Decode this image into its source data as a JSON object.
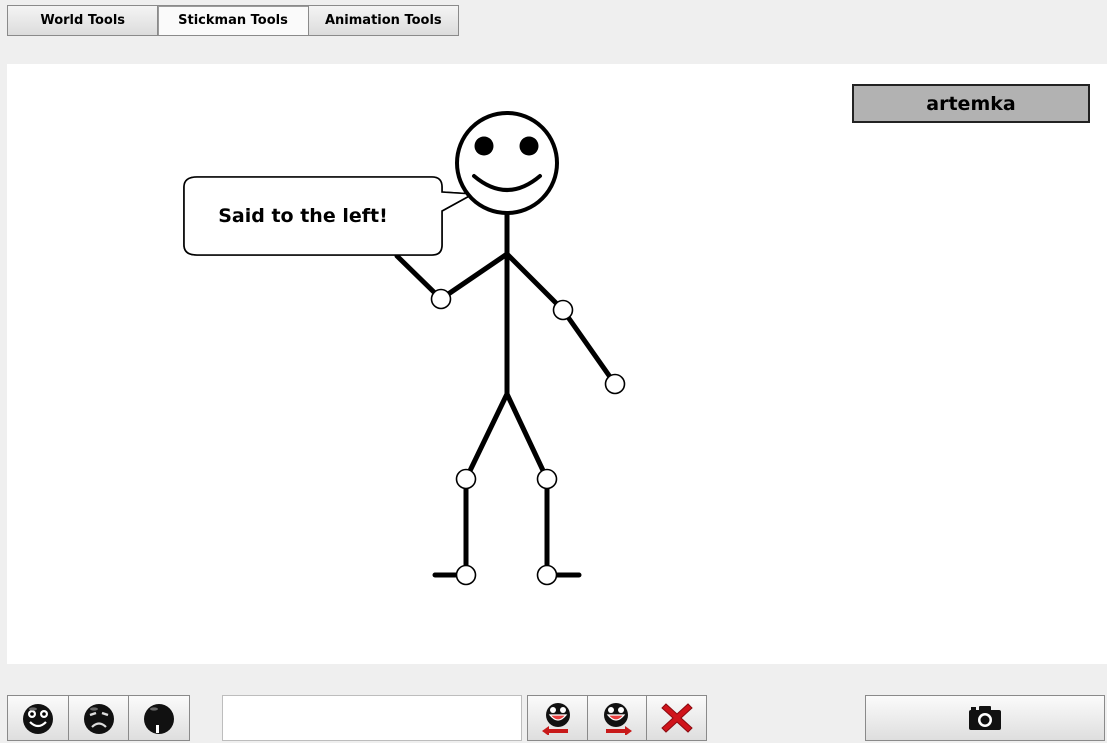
{
  "tabs": [
    {
      "label": "World Tools",
      "active": false
    },
    {
      "label": "Stickman Tools",
      "active": true
    },
    {
      "label": "Animation Tools",
      "active": false
    }
  ],
  "stage": {
    "player_name": "artemka",
    "speech_bubble": "Said to the left!"
  },
  "toolbar": {
    "emotions": [
      "smile-face-icon",
      "sad-face-icon",
      "surprised-face-icon"
    ],
    "say_input": {
      "value": "",
      "placeholder": ""
    },
    "actions": [
      "say-left-icon",
      "say-right-icon",
      "delete-icon"
    ],
    "camera_icon": "camera-icon"
  },
  "colors": {
    "canvas": "#ffffff",
    "background": "#efefef",
    "name_box": "#b2b2b2",
    "delete": "#d0141b",
    "arrow": "#c81a1a"
  }
}
